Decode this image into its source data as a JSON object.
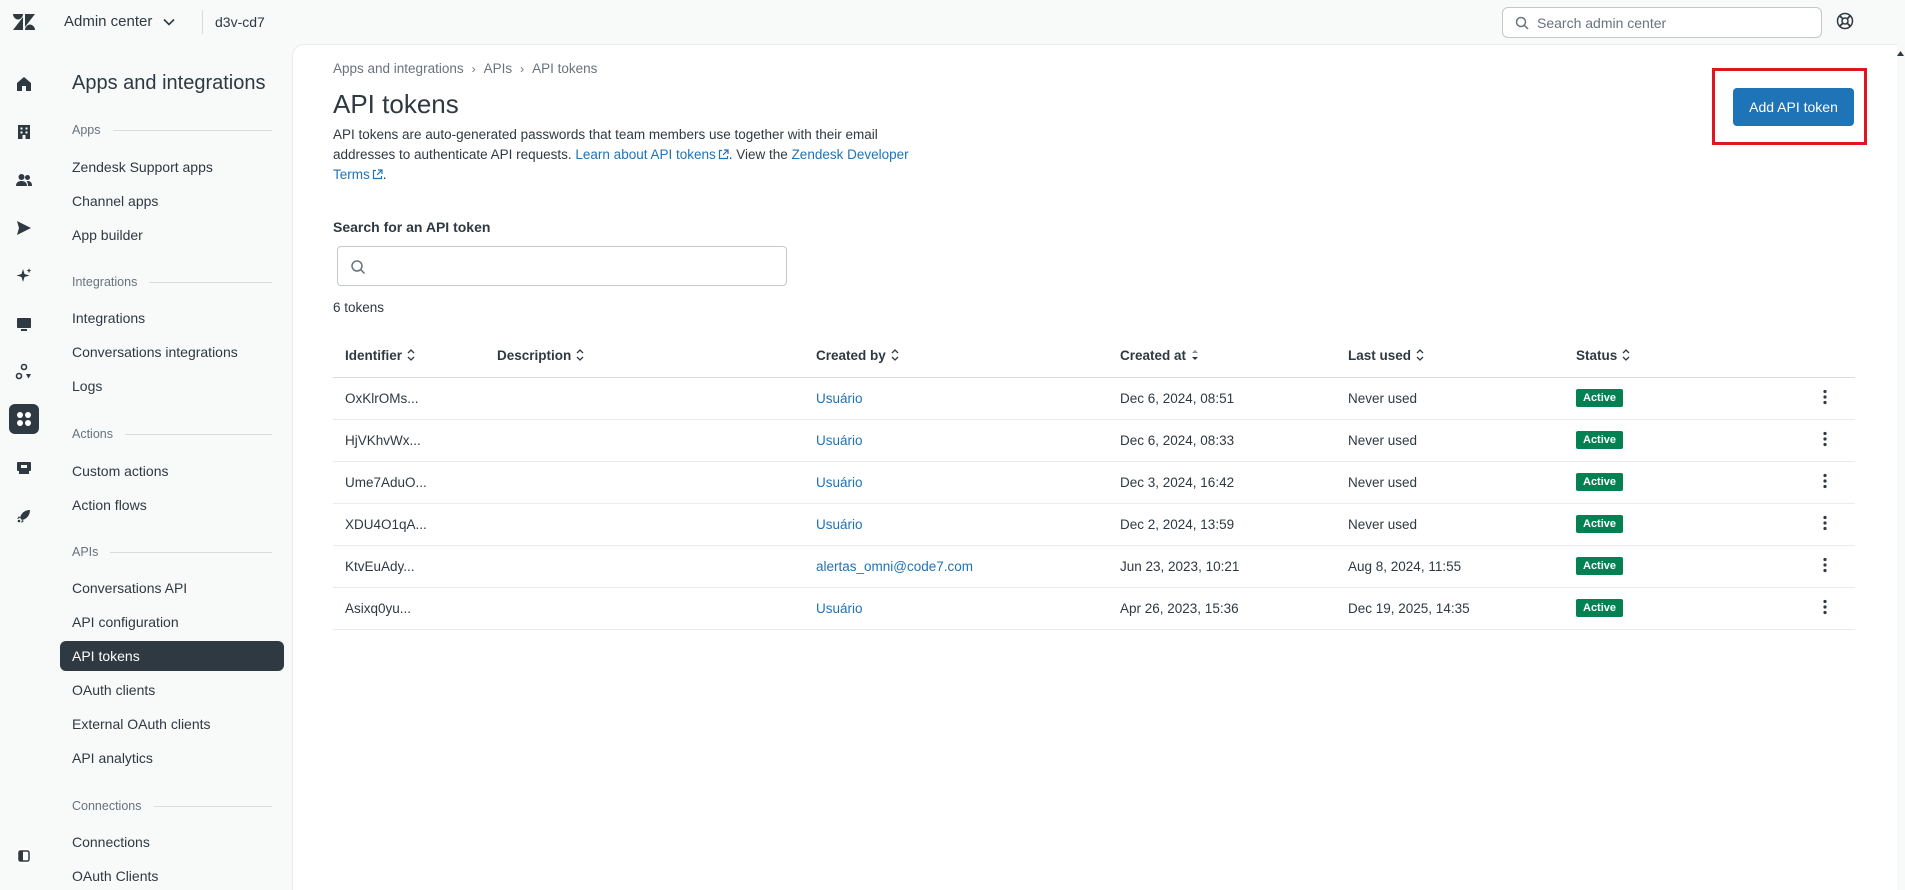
{
  "topbar": {
    "product": "Admin center",
    "account": "d3v-cd7",
    "search_placeholder": "Search admin center"
  },
  "nav": {
    "title": "Apps and integrations",
    "sections": [
      {
        "label": "Apps",
        "items": [
          "Zendesk Support apps",
          "Channel apps",
          "App builder"
        ]
      },
      {
        "label": "Integrations",
        "items": [
          "Integrations",
          "Conversations integrations",
          "Logs"
        ]
      },
      {
        "label": "Actions",
        "items": [
          "Custom actions",
          "Action flows"
        ]
      },
      {
        "label": "APIs",
        "items": [
          "Conversations API",
          "API configuration",
          "API tokens",
          "OAuth clients",
          "External OAuth clients",
          "API analytics"
        ]
      },
      {
        "label": "Connections",
        "items": [
          "Connections",
          "OAuth Clients"
        ]
      }
    ],
    "active_item": "API tokens"
  },
  "breadcrumb": [
    "Apps and integrations",
    "APIs",
    "API tokens"
  ],
  "page": {
    "title": "API tokens",
    "desc_part1": "API tokens are auto-generated passwords that team members use together with their email addresses to authenticate API requests. ",
    "desc_link1": "Learn about API tokens",
    "desc_part2": ". View the ",
    "desc_link2": "Zendesk Developer Terms",
    "desc_part3": ".",
    "add_button": "Add API token",
    "search_label": "Search for an API token",
    "token_count": "6 tokens"
  },
  "table": {
    "columns": [
      "Identifier",
      "Description",
      "Created by",
      "Created at",
      "Last used",
      "Status"
    ],
    "rows": [
      {
        "identifier": "OxKlrOMs...",
        "description": "",
        "created_by": "Usuário",
        "created_at": "Dec 6, 2024, 08:51",
        "last_used": "Never used",
        "status": "Active"
      },
      {
        "identifier": "HjVKhvWx...",
        "description": "",
        "created_by": "Usuário",
        "created_at": "Dec 6, 2024, 08:33",
        "last_used": "Never used",
        "status": "Active"
      },
      {
        "identifier": "Ume7AduO...",
        "description": "",
        "created_by": "Usuário",
        "created_at": "Dec 3, 2024, 16:42",
        "last_used": "Never used",
        "status": "Active"
      },
      {
        "identifier": "XDU4O1qA...",
        "description": "",
        "created_by": "Usuário",
        "created_at": "Dec 2, 2024, 13:59",
        "last_used": "Never used",
        "status": "Active"
      },
      {
        "identifier": "KtvEuAdy...",
        "description": "",
        "created_by": "alertas_omni@code7.com",
        "created_at": "Jun 23, 2023, 10:21",
        "last_used": "Aug 8, 2024, 11:55",
        "status": "Active"
      },
      {
        "identifier": "Asixq0yu...",
        "description": "",
        "created_by": "Usuário",
        "created_at": "Apr 26, 2023, 15:36",
        "last_used": "Dec 19, 2025, 14:35",
        "status": "Active"
      }
    ]
  },
  "colors": {
    "primary": "#1f73b7",
    "active_badge": "#038153",
    "highlight_frame": "#e0161f",
    "nav_active": "#2f3941"
  }
}
